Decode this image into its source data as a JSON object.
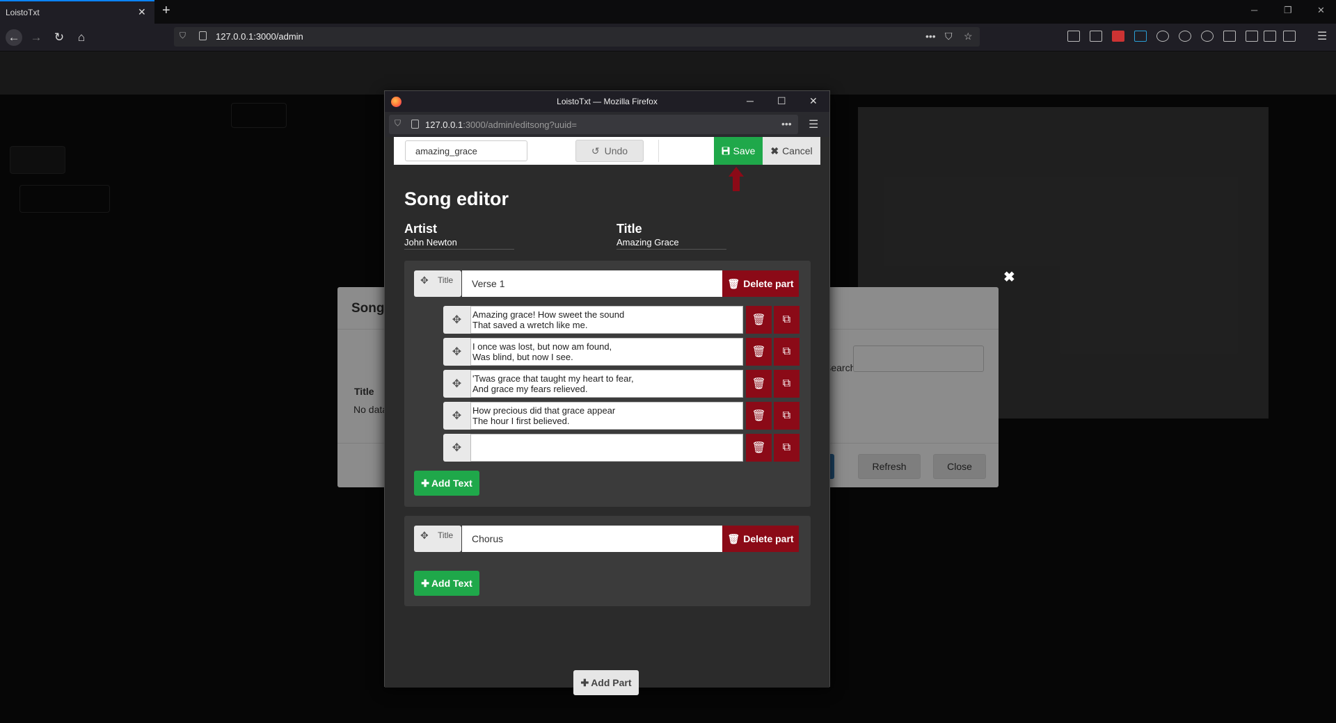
{
  "browser": {
    "tab_title": "LoistoTxt",
    "url": "127.0.0.1:3000/admin"
  },
  "songs_modal": {
    "title": "Songs",
    "column_title": "Title",
    "no_data": "No data",
    "search_label": "Search:",
    "refresh_label": "Refresh",
    "close_label": "Close"
  },
  "popup": {
    "window_title": "LoistoTxt — Mozilla Firefox",
    "url_host": "127.0.0.1",
    "url_path": ":3000/admin/editsong?uuid="
  },
  "editor": {
    "song_id": "amazing_grace",
    "undo_label": "Undo",
    "save_label": "Save",
    "cancel_label": "Cancel",
    "heading": "Song editor",
    "artist_label": "Artist",
    "artist_value": "John Newton",
    "title_label": "Title",
    "title_value": "Amazing Grace",
    "part_title_label": "Title",
    "delete_part_label": "Delete part",
    "add_text_label": "Add Text",
    "add_part_label": "Add Part",
    "parts": [
      {
        "title": "Verse 1",
        "lines": [
          "Amazing grace! How sweet the sound\nThat saved a wretch like me.",
          "I once was lost, but now am found,\nWas blind, but now I see.",
          "'Twas grace that taught my heart to fear,\nAnd grace my fears relieved.",
          "How precious did that grace appear\nThe hour I first believed.",
          ""
        ]
      },
      {
        "title": "Chorus",
        "lines": []
      }
    ]
  }
}
